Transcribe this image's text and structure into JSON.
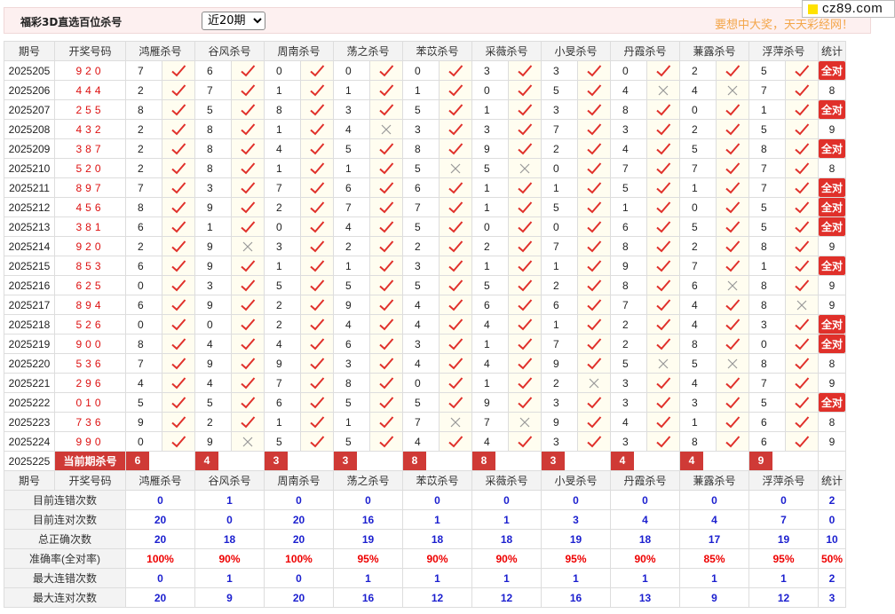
{
  "header": {
    "title": "福彩3D直选百位杀号",
    "period_select": "近20期",
    "slogan": "要想中大奖，天天彩经网！"
  },
  "logo": {
    "text": "cz89.com"
  },
  "table": {
    "col_period": "期号",
    "col_draw": "开奖号码",
    "col_stat": "统计",
    "experts": [
      "鸿雁杀号",
      "谷风杀号",
      "周南杀号",
      "荡之杀号",
      "苯苡杀号",
      "采薇杀号",
      "小旻杀号",
      "丹霞杀号",
      "蒹露杀号",
      "浮萍杀号"
    ],
    "rows": [
      {
        "period": "2025205",
        "draw": "920",
        "nums": [
          7,
          6,
          0,
          0,
          0,
          3,
          3,
          0,
          2,
          5
        ],
        "ok": [
          1,
          1,
          1,
          1,
          1,
          1,
          1,
          1,
          1,
          1
        ],
        "stat": "全对",
        "full": true
      },
      {
        "period": "2025206",
        "draw": "444",
        "nums": [
          2,
          7,
          1,
          1,
          1,
          0,
          5,
          4,
          4,
          7
        ],
        "ok": [
          1,
          1,
          1,
          1,
          1,
          1,
          1,
          0,
          0,
          1
        ],
        "stat": "8",
        "full": false
      },
      {
        "period": "2025207",
        "draw": "255",
        "nums": [
          8,
          5,
          8,
          3,
          5,
          1,
          3,
          8,
          0,
          1
        ],
        "ok": [
          1,
          1,
          1,
          1,
          1,
          1,
          1,
          1,
          1,
          1
        ],
        "stat": "全对",
        "full": true
      },
      {
        "period": "2025208",
        "draw": "432",
        "nums": [
          2,
          8,
          1,
          4,
          3,
          3,
          7,
          3,
          2,
          5
        ],
        "ok": [
          1,
          1,
          1,
          0,
          1,
          1,
          1,
          1,
          1,
          1
        ],
        "stat": "9",
        "full": false
      },
      {
        "period": "2025209",
        "draw": "387",
        "nums": [
          2,
          8,
          4,
          5,
          8,
          9,
          2,
          4,
          5,
          8
        ],
        "ok": [
          1,
          1,
          1,
          1,
          1,
          1,
          1,
          1,
          1,
          1
        ],
        "stat": "全对",
        "full": true
      },
      {
        "period": "2025210",
        "draw": "520",
        "nums": [
          2,
          8,
          1,
          1,
          5,
          5,
          0,
          7,
          7,
          7
        ],
        "ok": [
          1,
          1,
          1,
          1,
          0,
          0,
          1,
          1,
          1,
          1
        ],
        "stat": "8",
        "full": false
      },
      {
        "period": "2025211",
        "draw": "897",
        "nums": [
          7,
          3,
          7,
          6,
          6,
          1,
          1,
          5,
          1,
          7
        ],
        "ok": [
          1,
          1,
          1,
          1,
          1,
          1,
          1,
          1,
          1,
          1
        ],
        "stat": "全对",
        "full": true
      },
      {
        "period": "2025212",
        "draw": "456",
        "nums": [
          8,
          9,
          2,
          7,
          7,
          1,
          5,
          1,
          0,
          5
        ],
        "ok": [
          1,
          1,
          1,
          1,
          1,
          1,
          1,
          1,
          1,
          1
        ],
        "stat": "全对",
        "full": true
      },
      {
        "period": "2025213",
        "draw": "381",
        "nums": [
          6,
          1,
          0,
          4,
          5,
          0,
          0,
          6,
          5,
          5
        ],
        "ok": [
          1,
          1,
          1,
          1,
          1,
          1,
          1,
          1,
          1,
          1
        ],
        "stat": "全对",
        "full": true
      },
      {
        "period": "2025214",
        "draw": "920",
        "nums": [
          2,
          9,
          3,
          2,
          2,
          2,
          7,
          8,
          2,
          8
        ],
        "ok": [
          1,
          0,
          1,
          1,
          1,
          1,
          1,
          1,
          1,
          1
        ],
        "stat": "9",
        "full": false
      },
      {
        "period": "2025215",
        "draw": "853",
        "nums": [
          6,
          9,
          1,
          1,
          3,
          1,
          1,
          9,
          7,
          1
        ],
        "ok": [
          1,
          1,
          1,
          1,
          1,
          1,
          1,
          1,
          1,
          1
        ],
        "stat": "全对",
        "full": true
      },
      {
        "period": "2025216",
        "draw": "625",
        "nums": [
          0,
          3,
          5,
          5,
          5,
          5,
          2,
          8,
          6,
          8
        ],
        "ok": [
          1,
          1,
          1,
          1,
          1,
          1,
          1,
          1,
          0,
          1
        ],
        "stat": "9",
        "full": false
      },
      {
        "period": "2025217",
        "draw": "894",
        "nums": [
          6,
          9,
          2,
          9,
          4,
          6,
          6,
          7,
          4,
          8
        ],
        "ok": [
          1,
          1,
          1,
          1,
          1,
          1,
          1,
          1,
          1,
          0
        ],
        "stat": "9",
        "full": false
      },
      {
        "period": "2025218",
        "draw": "526",
        "nums": [
          0,
          0,
          2,
          4,
          4,
          4,
          1,
          2,
          4,
          3
        ],
        "ok": [
          1,
          1,
          1,
          1,
          1,
          1,
          1,
          1,
          1,
          1
        ],
        "stat": "全对",
        "full": true
      },
      {
        "period": "2025219",
        "draw": "900",
        "nums": [
          8,
          4,
          4,
          6,
          3,
          1,
          7,
          2,
          8,
          0
        ],
        "ok": [
          1,
          1,
          1,
          1,
          1,
          1,
          1,
          1,
          1,
          1
        ],
        "stat": "全对",
        "full": true
      },
      {
        "period": "2025220",
        "draw": "536",
        "nums": [
          7,
          9,
          9,
          3,
          4,
          4,
          9,
          5,
          5,
          8
        ],
        "ok": [
          1,
          1,
          1,
          1,
          1,
          1,
          1,
          0,
          0,
          1
        ],
        "stat": "8",
        "full": false
      },
      {
        "period": "2025221",
        "draw": "296",
        "nums": [
          4,
          4,
          7,
          8,
          0,
          1,
          2,
          3,
          4,
          7
        ],
        "ok": [
          1,
          1,
          1,
          1,
          1,
          1,
          0,
          1,
          1,
          1
        ],
        "stat": "9",
        "full": false
      },
      {
        "period": "2025222",
        "draw": "010",
        "nums": [
          5,
          5,
          6,
          5,
          5,
          9,
          3,
          3,
          3,
          5
        ],
        "ok": [
          1,
          1,
          1,
          1,
          1,
          1,
          1,
          1,
          1,
          1
        ],
        "stat": "全对",
        "full": true
      },
      {
        "period": "2025223",
        "draw": "736",
        "nums": [
          9,
          2,
          1,
          1,
          7,
          7,
          9,
          4,
          1,
          6
        ],
        "ok": [
          1,
          1,
          1,
          1,
          0,
          0,
          1,
          1,
          1,
          1
        ],
        "stat": "8",
        "full": false
      },
      {
        "period": "2025224",
        "draw": "990",
        "nums": [
          0,
          9,
          5,
          5,
          4,
          4,
          3,
          3,
          8,
          6
        ],
        "ok": [
          1,
          0,
          1,
          1,
          1,
          1,
          1,
          1,
          1,
          1
        ],
        "stat": "9",
        "full": false
      }
    ],
    "current": {
      "period": "2025225",
      "label": "当前期杀号",
      "nums": [
        6,
        4,
        3,
        3,
        8,
        8,
        3,
        4,
        4,
        9
      ]
    },
    "summary": [
      {
        "label": "目前连错次数",
        "values": [
          "0",
          "1",
          "0",
          "0",
          "0",
          "0",
          "0",
          "0",
          "0",
          "0"
        ],
        "stat": "2",
        "red": false
      },
      {
        "label": "目前连对次数",
        "values": [
          "20",
          "0",
          "20",
          "16",
          "1",
          "1",
          "3",
          "4",
          "4",
          "7"
        ],
        "stat": "0",
        "red": false
      },
      {
        "label": "总正确次数",
        "values": [
          "20",
          "18",
          "20",
          "19",
          "18",
          "18",
          "19",
          "18",
          "17",
          "19"
        ],
        "stat": "10",
        "red": false
      },
      {
        "label": "准确率(全对率)",
        "values": [
          "100%",
          "90%",
          "100%",
          "95%",
          "90%",
          "90%",
          "95%",
          "90%",
          "85%",
          "95%"
        ],
        "stat": "50%",
        "red": true
      },
      {
        "label": "最大连错次数",
        "values": [
          "0",
          "1",
          "0",
          "1",
          "1",
          "1",
          "1",
          "1",
          "1",
          "1"
        ],
        "stat": "2",
        "red": false
      },
      {
        "label": "最大连对次数",
        "values": [
          "20",
          "9",
          "20",
          "16",
          "12",
          "12",
          "16",
          "13",
          "9",
          "12"
        ],
        "stat": "3",
        "red": false
      }
    ]
  }
}
